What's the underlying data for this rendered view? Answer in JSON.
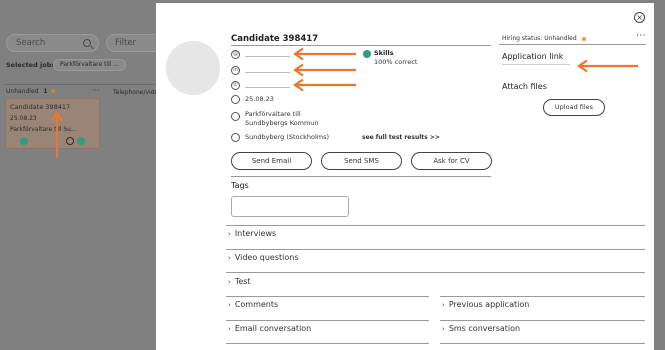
{
  "background": {
    "search_placeholder": "Search",
    "filter_placeholder": "Filter",
    "selected_jobs_label": "Selected jobs:",
    "selected_job_chip": "Parkförvaltare till ...",
    "column_unhandled_label": "Unhandled",
    "column_unhandled_count": "1",
    "column_more": "···",
    "column_next_label": "Telephone/vide",
    "card": {
      "name": "Candidate 398417",
      "date": "25.08.23",
      "job": "Parkförvaltare till Su..."
    }
  },
  "candidate": {
    "title": "Candidate 398417",
    "date": "25.08.23",
    "job": "Parkförvaltare till Sundbybergs Kommun",
    "location": "Sundbyberg (Stockholms)",
    "skills_title": "Skills",
    "skills_result": "100% correct",
    "see_full_results": "see full test results >>"
  },
  "actions": {
    "send_email": "Send Email",
    "send_sms": "Send SMS",
    "ask_cv": "Ask for CV"
  },
  "tags": {
    "label": "Tags"
  },
  "sidebar": {
    "hiring_status_label": "Hiring status:",
    "hiring_status_value": "Unhandled",
    "more": "···",
    "application_link": "Application link",
    "attach_files": "Attach files",
    "upload_files": "Upload files"
  },
  "sections": {
    "interviews": "Interviews",
    "video_questions": "Video questions",
    "test": "Test",
    "comments": "Comments",
    "previous_application": "Previous application",
    "email_conversation": "Email conversation",
    "sms_conversation": "Sms conversation"
  },
  "colors": {
    "arrow": "#e8782a",
    "skills_dot": "#2e9e7e",
    "status_dot": "#e8a035"
  }
}
